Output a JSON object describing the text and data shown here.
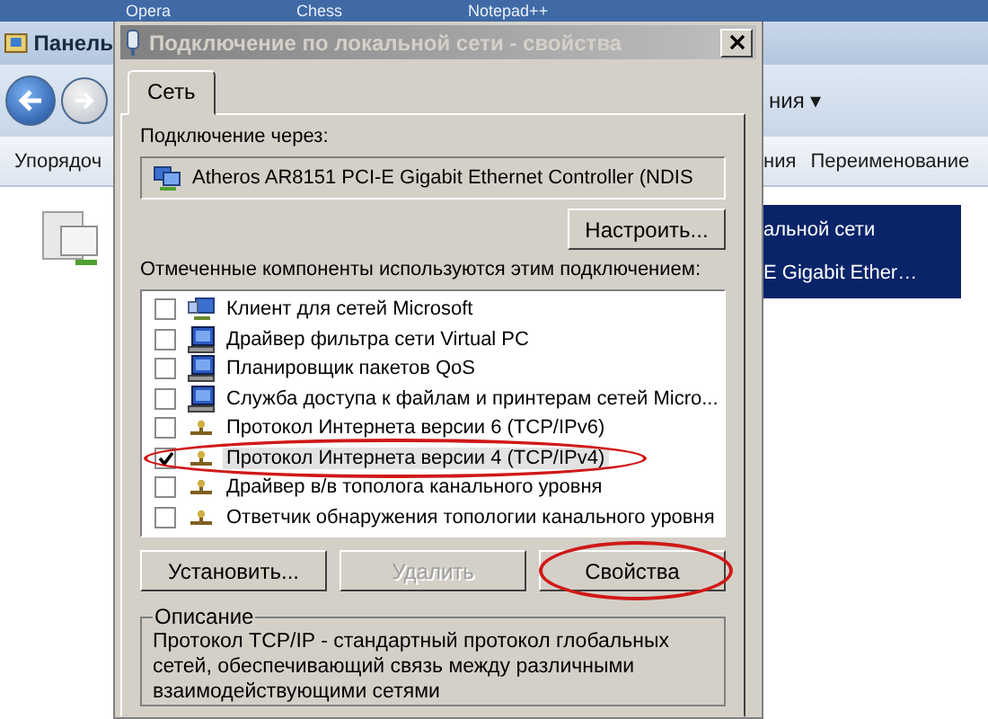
{
  "taskbar": {
    "items": [
      "Opera",
      "Chess",
      "Notepad++"
    ]
  },
  "explorer": {
    "title": "Панель",
    "nav_menu": "ния",
    "menu_arrow": "▾",
    "command_left": "Упорядоч",
    "commands_right": [
      "ния",
      "Переименование"
    ],
    "selected_item": {
      "name": "альной сети",
      "detail": "E Gigabit Ether…"
    }
  },
  "dialog": {
    "title": "Подключение по локальной сети - свойства",
    "tabs": [
      {
        "label": "Сеть",
        "selected": true
      }
    ],
    "connect_label": "Подключение через:",
    "adapter": "Atheros AR8151 PCI-E Gigabit Ethernet Controller (NDIS",
    "configure_button": "Настроить...",
    "components_label": "Отмеченные компоненты используются этим подключением:",
    "components": [
      {
        "label": "Клиент для сетей Microsoft",
        "kind": "client",
        "checked": false,
        "selected": false,
        "circled": false
      },
      {
        "label": "Драйвер фильтра сети Virtual PC",
        "kind": "service",
        "checked": false,
        "selected": false,
        "circled": false
      },
      {
        "label": "Планировщик пакетов QoS",
        "kind": "service",
        "checked": false,
        "selected": false,
        "circled": false
      },
      {
        "label": "Служба доступа к файлам и принтерам сетей Micro...",
        "kind": "service",
        "checked": false,
        "selected": false,
        "circled": false
      },
      {
        "label": "Протокол Интернета версии 6 (TCP/IPv6)",
        "kind": "protocol",
        "checked": false,
        "selected": false,
        "circled": false
      },
      {
        "label": "Протокол Интернета версии 4 (TCP/IPv4)",
        "kind": "protocol",
        "checked": true,
        "selected": true,
        "circled": true
      },
      {
        "label": "Драйвер в/в тополога канального уровня",
        "kind": "protocol",
        "checked": false,
        "selected": false,
        "circled": false
      },
      {
        "label": "Ответчик обнаружения топологии канального уровня",
        "kind": "protocol",
        "checked": false,
        "selected": false,
        "circled": false
      }
    ],
    "buttons": [
      {
        "label": "Установить...",
        "disabled": false,
        "circled": false
      },
      {
        "label": "Удалить",
        "disabled": true,
        "circled": false
      },
      {
        "label": "Свойства",
        "disabled": false,
        "circled": true
      }
    ],
    "description": {
      "legend": "Описание",
      "text": "Протокол TCP/IP - стандартный протокол глобальных сетей, обеспечивающий связь между различными взаимодействующими сетями"
    }
  }
}
